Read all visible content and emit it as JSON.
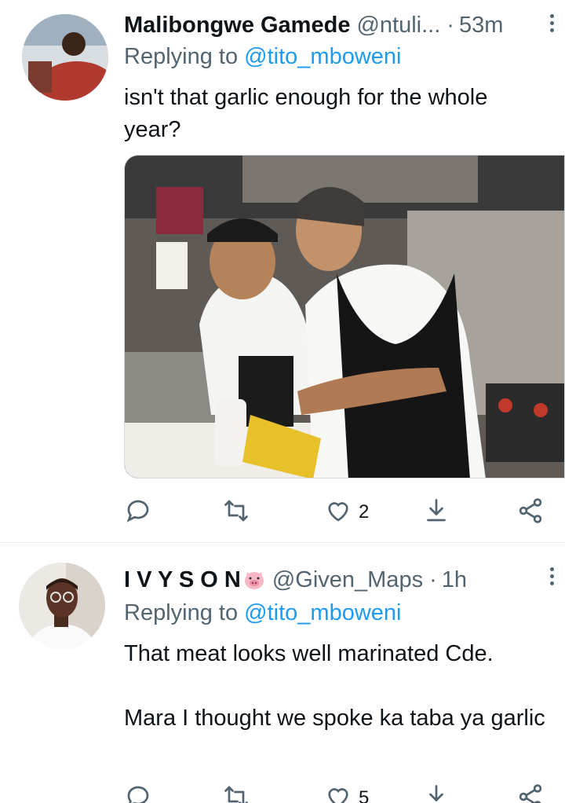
{
  "tweets": [
    {
      "display_name": "Malibongwe Gamede",
      "handle": "@ntuli...",
      "dot": "·",
      "time": "53m",
      "replying_label": "Replying to",
      "replying_to": "@tito_mboweni",
      "text": "isn't that garlic enough for the whole year?",
      "replies": "",
      "retweets": "",
      "likes": "2"
    },
    {
      "display_name": "I V Y S O N",
      "handle": "@Given_Maps",
      "dot": "·",
      "time": "1h",
      "replying_label": "Replying to",
      "replying_to": "@tito_mboweni",
      "text_line1": "That meat looks well marinated Cde.",
      "text_line2": "Mara I thought we spoke ka taba ya garlic",
      "likes": "5"
    }
  ],
  "icons": {
    "reply": "reply-icon",
    "retweet": "retweet-icon",
    "like": "heart-icon",
    "share": "share-icon",
    "more": "more-icon"
  },
  "colors": {
    "accent": "#1d9bf0",
    "secondary_text": "#536471",
    "primary_text": "#0f1419"
  }
}
